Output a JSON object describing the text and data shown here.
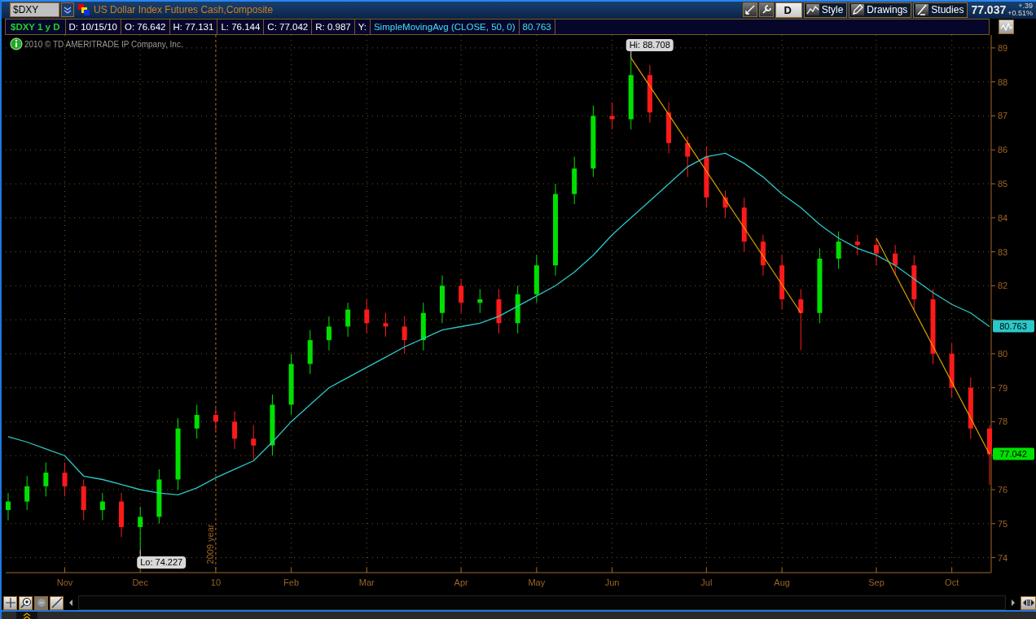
{
  "window": {
    "symbol": "$DXY",
    "title": "US Dollar Index Futures Cash,Composite",
    "toolbar": [
      {
        "label": "D",
        "kind": "period"
      },
      {
        "label": "Style",
        "kind": "style"
      },
      {
        "label": "Drawings",
        "kind": "drawings"
      },
      {
        "label": "Studies",
        "kind": "studies"
      }
    ],
    "last_price": "77.037",
    "change": "+.39",
    "change_pct": "+0.51%"
  },
  "info_bar": [
    {
      "text": "$DXY 1 y D",
      "kind": "symbol"
    },
    {
      "text": "D: 10/15/10",
      "kind": "field"
    },
    {
      "text": "O: 76.642",
      "kind": "field"
    },
    {
      "text": "H: 77.131",
      "kind": "field"
    },
    {
      "text": "L: 76.144",
      "kind": "field"
    },
    {
      "text": "C: 77.042",
      "kind": "field"
    },
    {
      "text": "R: 0.987",
      "kind": "field"
    },
    {
      "text": "Y:",
      "kind": "field"
    },
    {
      "text": "SimpleMovingAvg (CLOSE, 50, 0)",
      "kind": "study"
    },
    {
      "text": "80.763",
      "kind": "study"
    }
  ],
  "chart": {
    "copyright": "2010 © TD AMERITRADE IP Company, Inc.",
    "chart_data": {
      "type": "candlestick",
      "categories": [
        null,
        null,
        null,
        "Nov",
        null,
        null,
        null,
        "Dec",
        null,
        null,
        null,
        "10",
        null,
        null,
        null,
        "Feb",
        null,
        null,
        null,
        "Mar",
        null,
        null,
        null,
        null,
        "Apr",
        null,
        null,
        null,
        "May",
        null,
        null,
        null,
        "Jun",
        null,
        null,
        null,
        null,
        "Jul",
        null,
        null,
        null,
        "Aug",
        null,
        null,
        null,
        null,
        "Sep",
        null,
        null,
        null,
        "Oct",
        null,
        null
      ],
      "ohlc": [
        [
          75.4,
          75.9,
          75.1,
          75.65
        ],
        [
          75.65,
          76.4,
          75.4,
          76.1
        ],
        [
          76.1,
          76.8,
          75.8,
          76.5
        ],
        [
          76.5,
          76.8,
          75.8,
          76.1
        ],
        [
          76.1,
          76.3,
          75.1,
          75.4
        ],
        [
          75.4,
          75.9,
          75.1,
          75.65
        ],
        [
          75.65,
          75.9,
          74.6,
          74.9
        ],
        [
          74.9,
          75.5,
          74.227,
          75.2
        ],
        [
          75.2,
          76.6,
          75.0,
          76.3
        ],
        [
          76.3,
          78.1,
          76.0,
          77.8
        ],
        [
          77.8,
          78.5,
          77.5,
          78.2
        ],
        [
          78.2,
          78.4,
          77.7,
          78.0
        ],
        [
          78.0,
          78.3,
          77.2,
          77.5
        ],
        [
          77.5,
          77.9,
          76.9,
          77.3
        ],
        [
          77.3,
          78.8,
          77.0,
          78.5
        ],
        [
          78.5,
          80.0,
          78.2,
          79.7
        ],
        [
          79.7,
          80.7,
          79.4,
          80.4
        ],
        [
          80.4,
          81.1,
          80.1,
          80.8
        ],
        [
          80.8,
          81.5,
          80.5,
          81.3
        ],
        [
          81.3,
          81.6,
          80.6,
          80.9
        ],
        [
          80.9,
          81.2,
          80.5,
          80.8
        ],
        [
          80.8,
          81.1,
          80.0,
          80.4
        ],
        [
          80.4,
          81.5,
          80.1,
          81.2
        ],
        [
          81.2,
          82.3,
          80.9,
          82.0
        ],
        [
          82.0,
          82.2,
          81.2,
          81.5
        ],
        [
          81.5,
          81.9,
          81.2,
          81.6
        ],
        [
          81.6,
          81.9,
          80.6,
          80.9
        ],
        [
          80.9,
          82.0,
          80.6,
          81.75
        ],
        [
          81.75,
          82.9,
          81.5,
          82.6
        ],
        [
          82.6,
          85.0,
          82.3,
          84.7
        ],
        [
          84.7,
          85.8,
          84.4,
          85.45
        ],
        [
          85.45,
          87.3,
          85.2,
          87.0
        ],
        [
          87.0,
          87.4,
          86.6,
          86.9
        ],
        [
          86.9,
          88.708,
          86.6,
          88.2
        ],
        [
          88.2,
          88.5,
          86.8,
          87.1
        ],
        [
          87.1,
          87.4,
          85.9,
          86.2
        ],
        [
          86.2,
          86.4,
          85.2,
          85.8
        ],
        [
          85.8,
          86.1,
          84.3,
          84.6
        ],
        [
          84.6,
          84.8,
          84.0,
          84.3
        ],
        [
          84.3,
          84.6,
          83.0,
          83.3
        ],
        [
          83.3,
          83.5,
          82.3,
          82.6
        ],
        [
          82.6,
          82.9,
          81.3,
          81.6
        ],
        [
          81.6,
          81.9,
          80.1,
          81.2
        ],
        [
          81.2,
          83.1,
          80.9,
          82.8
        ],
        [
          82.8,
          83.6,
          82.5,
          83.3
        ],
        [
          83.3,
          83.5,
          82.9,
          83.2
        ],
        [
          83.2,
          83.4,
          82.6,
          82.95
        ],
        [
          82.95,
          83.2,
          82.3,
          82.6
        ],
        [
          82.6,
          82.9,
          81.3,
          81.6
        ],
        [
          81.6,
          81.9,
          79.7,
          80.0
        ],
        [
          80.0,
          80.3,
          78.7,
          79.0
        ],
        [
          79.0,
          79.3,
          77.5,
          77.8
        ],
        [
          77.8,
          77.9,
          76.144,
          77.042
        ]
      ],
      "series": [
        {
          "type": "line",
          "color": "#2cc8c8",
          "values": [
            77.56,
            77.4,
            77.2,
            77.0,
            76.4,
            76.3,
            76.15,
            76.0,
            75.9,
            75.85,
            76.05,
            76.35,
            76.6,
            76.85,
            77.4,
            78.0,
            78.5,
            79.0,
            79.3,
            79.6,
            79.9,
            80.2,
            80.45,
            80.7,
            80.8,
            80.9,
            81.1,
            81.4,
            81.7,
            82.0,
            82.4,
            82.9,
            83.5,
            84.0,
            84.5,
            85.0,
            85.5,
            85.8,
            85.9,
            85.6,
            85.2,
            84.7,
            84.3,
            83.8,
            83.4,
            83.1,
            82.9,
            82.6,
            82.2,
            81.8,
            81.45,
            81.2,
            80.8
          ]
        }
      ],
      "ylim": [
        73.63,
        89.38
      ],
      "grid": true,
      "yticks": [
        74,
        75,
        76,
        78,
        79,
        80,
        82,
        83,
        84,
        85,
        86,
        87,
        88,
        89
      ],
      "annotations": [
        "Hi: 88.708",
        "Lo: 74.227",
        "2009 year",
        "80.763",
        "77.042"
      ]
    }
  }
}
